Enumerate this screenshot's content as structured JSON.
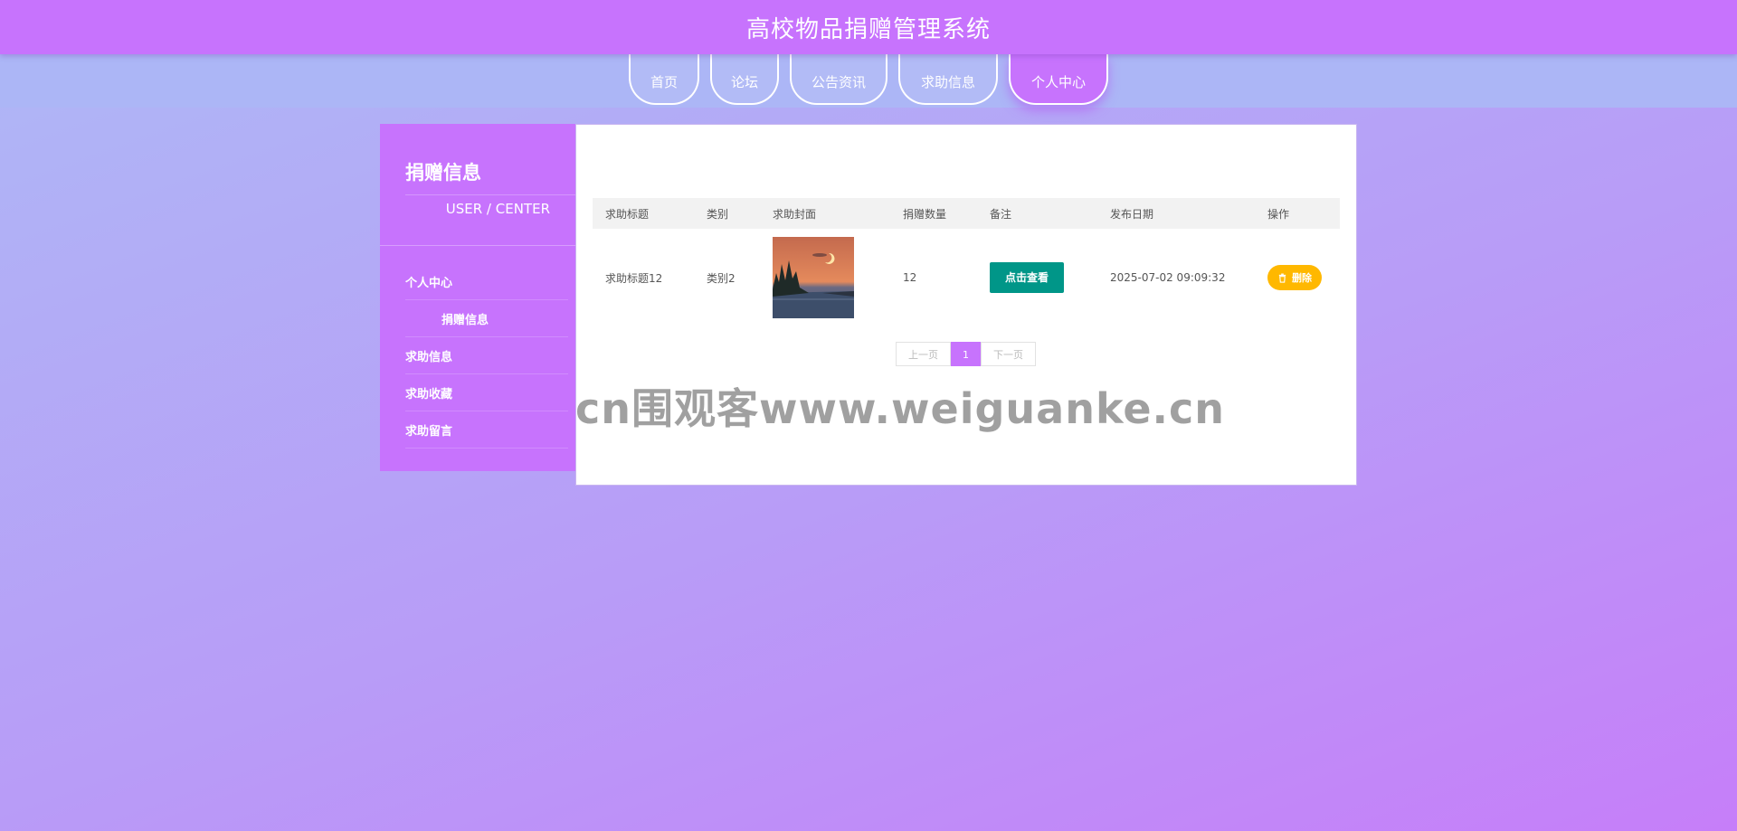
{
  "header": {
    "title": "高校物品捐赠管理系统"
  },
  "nav": {
    "items": [
      {
        "label": "首页"
      },
      {
        "label": "论坛"
      },
      {
        "label": "公告资讯"
      },
      {
        "label": "求助信息"
      },
      {
        "label": "个人中心",
        "active": true
      }
    ]
  },
  "sidebar": {
    "title": "捐赠信息",
    "subtitle": "USER / CENTER",
    "items": [
      {
        "label": "个人中心"
      },
      {
        "label": "捐赠信息",
        "sub": true
      },
      {
        "label": "求助信息"
      },
      {
        "label": "求助收藏"
      },
      {
        "label": "求助留言"
      }
    ]
  },
  "table": {
    "headers": [
      "求助标题",
      "类别",
      "求助封面",
      "捐赠数量",
      "备注",
      "发布日期",
      "操作"
    ],
    "rows": [
      {
        "title": "求助标题12",
        "category": "类别2",
        "quantity": "12",
        "remark_button": "点击查看",
        "date": "2025-07-02 09:09:32",
        "delete_button": "删除"
      }
    ]
  },
  "pagination": {
    "prev": "上一页",
    "current": "1",
    "next": "下一页"
  },
  "watermark": "cn围观客www.weiguanke.cn",
  "colors": {
    "accent": "#c773fd",
    "view_button": "#009688",
    "delete_button": "#ffb800"
  }
}
